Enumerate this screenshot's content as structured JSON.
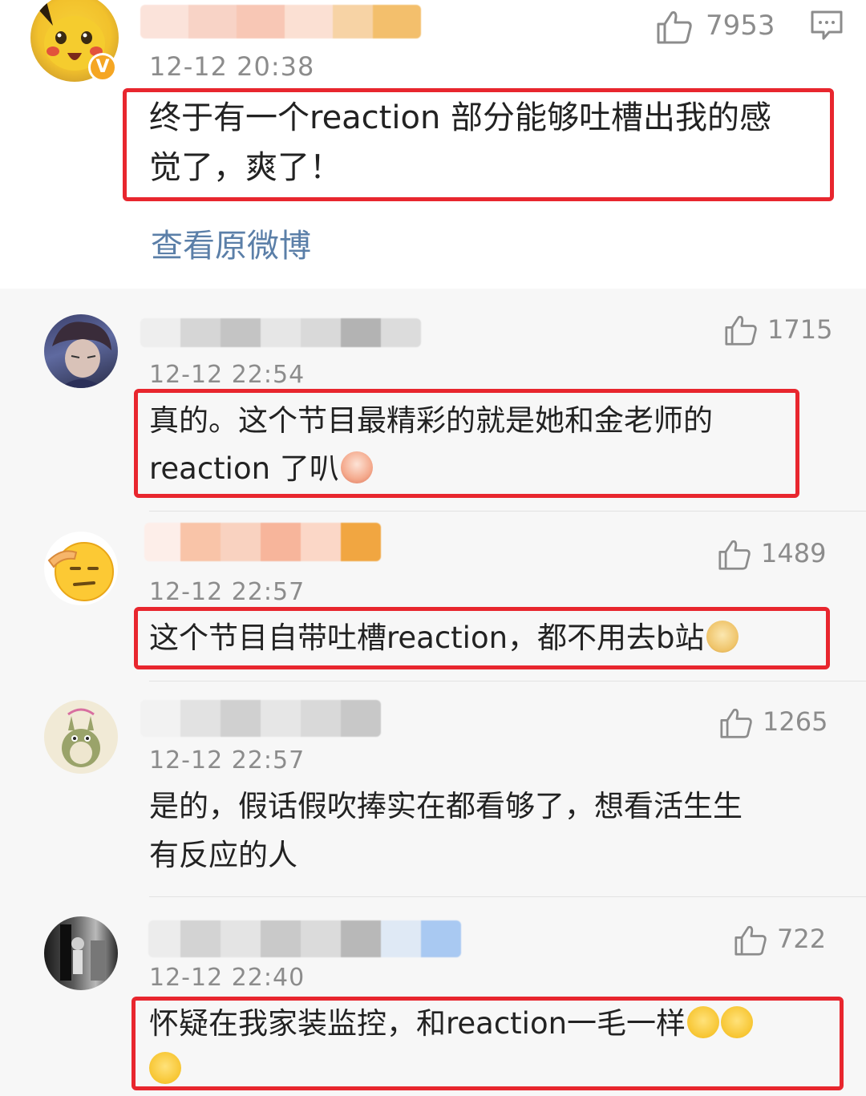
{
  "top_comment": {
    "avatar": "pikachu-avatar",
    "verified_badge": "V",
    "time": "12-12 20:38",
    "like_count": "7953",
    "text_line1": "终于有一个reaction 部分能够吐槽出我的感",
    "text_line2": "觉了，爽了！",
    "view_original": "查看原微博"
  },
  "replies": [
    {
      "avatar": "anime-portrait-avatar",
      "time": "12-12 22:54",
      "like_count": "1715",
      "text_line1": "真的。这个节目最精彩的就是她和金老师的",
      "text_line2": "reaction 了叭"
    },
    {
      "avatar": "salute-emoji-avatar",
      "time": "12-12 22:57",
      "like_count": "1489",
      "text_line1": "这个节目自带吐槽reaction，都不用去b站"
    },
    {
      "avatar": "totoro-avatar",
      "time": "12-12 22:57",
      "like_count": "1265",
      "text_line1": "是的，假话假吹捧实在都看够了，想看活生生",
      "text_line2": "有反应的人"
    },
    {
      "avatar": "street-photo-avatar",
      "time": "12-12 22:40",
      "like_count": "722",
      "text_line1": "怀疑在我家装监控，和reaction一毛一样"
    }
  ],
  "colors": {
    "highlight_box": "#e8262e",
    "link": "#5b7fa8",
    "meta_text": "#8c8c8c",
    "verified_badge": "#f5a623"
  },
  "icons": [
    "thumbs-up-icon",
    "comment-icon",
    "laughing-crying-emoji",
    "doge-emoji",
    "wave-emoji"
  ]
}
